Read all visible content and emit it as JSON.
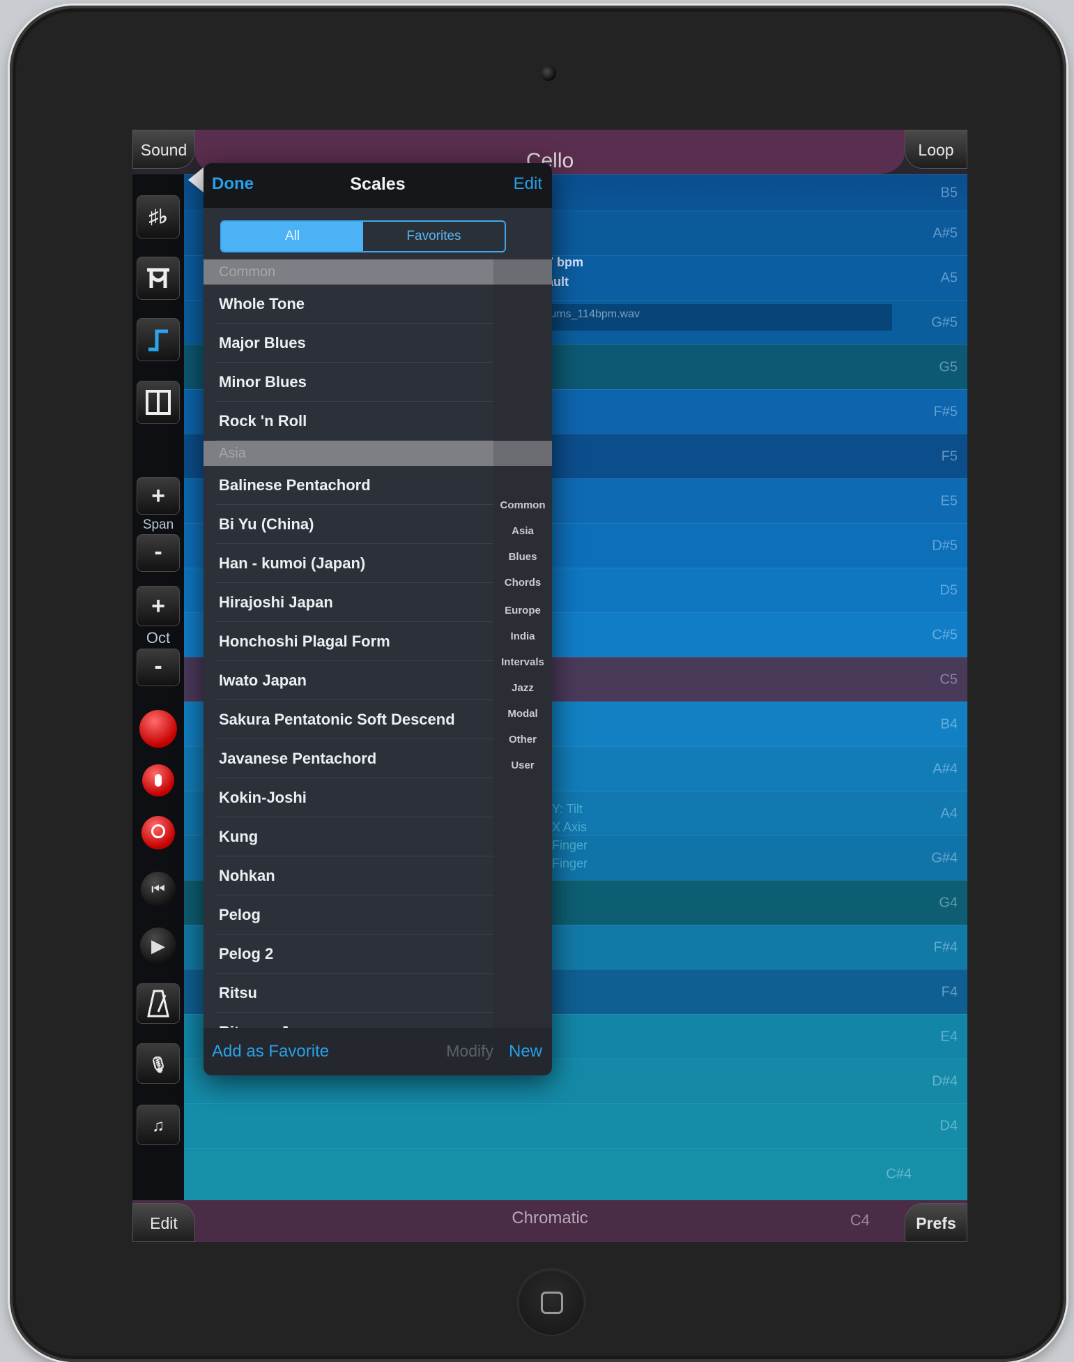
{
  "top_bar": {
    "sound_label": "Sound",
    "instrument": "Cello",
    "loop_label": "Loop"
  },
  "bottom_bar": {
    "edit_label": "Edit",
    "scale": "Chromatic",
    "root": "C4",
    "prefs_label": "Prefs"
  },
  "toolbar": {
    "sharp_flat": "♯♭",
    "span_label": "Span",
    "oct_label": "Oct",
    "plus": "+",
    "minus": "-"
  },
  "notes": [
    "B5",
    "A#5",
    "A5",
    "G#5",
    "G5",
    "F#5",
    "F5",
    "E5",
    "D#5",
    "D5",
    "C#5",
    "C5",
    "B4",
    "A#4",
    "A4",
    "G#4",
    "G4",
    "F#4",
    "F4",
    "E4",
    "D#4",
    "D4",
    "C#4"
  ],
  "background_text": {
    "bpm": "7 bpm",
    "default": "ault",
    "wav": "rums_114bpm.wav",
    "tilt": "Y: Tilt",
    "xaxis": "X Axis",
    "finger1": "Finger",
    "finger2": "Finger"
  },
  "popover": {
    "done_label": "Done",
    "title": "Scales",
    "edit_label": "Edit",
    "segments": {
      "all": "All",
      "favorites": "Favorites"
    },
    "sections": [
      {
        "title": "Common",
        "items": [
          "Whole Tone",
          "Major Blues",
          "Minor Blues",
          "Rock 'n Roll"
        ]
      },
      {
        "title": "Asia",
        "items": [
          "Balinese Pentachord",
          "Bi Yu (China)",
          "Han - kumoi (Japan)",
          "Hirajoshi Japan",
          "Honchoshi Plagal Form",
          "Iwato Japan",
          "Sakura Pentatonic Soft Descend",
          "Javanese Pentachord",
          "Kokin-Joshi",
          "Kung",
          "Nohkan",
          "Pelog",
          "Pelog 2",
          "Ritsu",
          "Ritsuon Japan"
        ]
      }
    ],
    "index": [
      "Common",
      "Asia",
      "Blues",
      "Chords",
      "Europe",
      "India",
      "Intervals",
      "Jazz",
      "Modal",
      "Other",
      "User"
    ],
    "footer": {
      "add_favorite": "Add as Favorite",
      "modify": "Modify",
      "new": "New"
    }
  },
  "colors": {
    "accent_blue": "#28a0e8",
    "maroon": "#5a2e4e"
  }
}
